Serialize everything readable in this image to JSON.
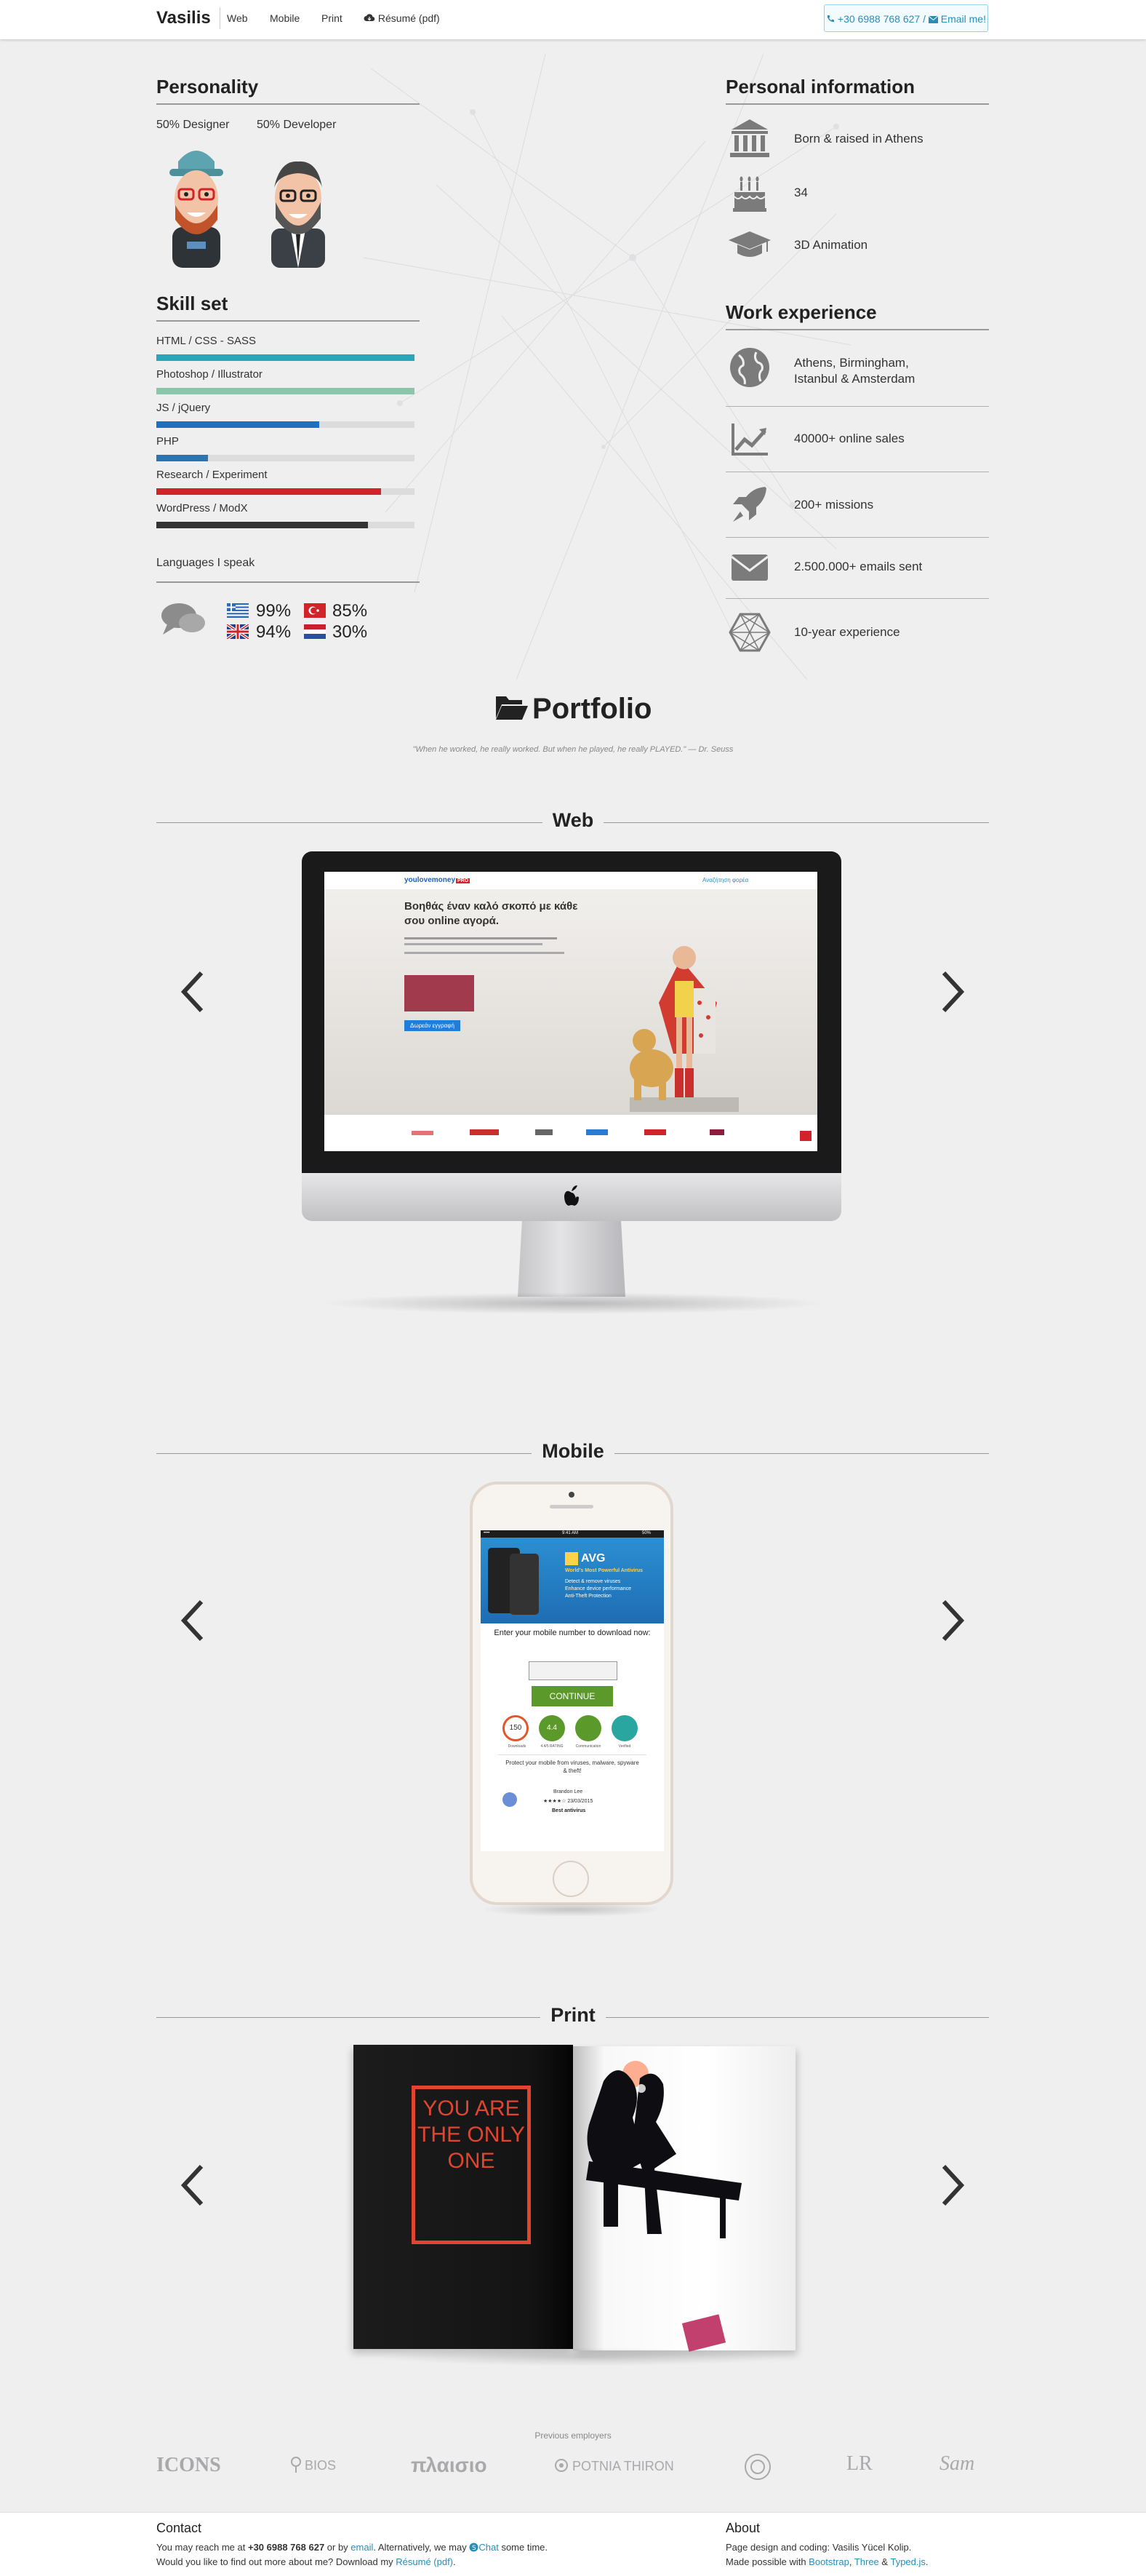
{
  "nav": {
    "brand": "Vasilis",
    "links": [
      "Web",
      "Mobile",
      "Print",
      "Résumé (pdf)"
    ],
    "phone": "+30 6988 768 627",
    "separator": "/",
    "email_label": "Email me!"
  },
  "personality": {
    "title": "Personality",
    "designer": "50% Designer",
    "developer": "50% Developer"
  },
  "skills": {
    "title": "Skill set",
    "items": [
      {
        "label": "HTML / CSS - SASS",
        "level": 1.0,
        "color": "#29a6b8"
      },
      {
        "label": "Photoshop / Illustrator",
        "level": 1.0,
        "color": "#8cc6aa"
      },
      {
        "label": "JS / jQuery",
        "level": 0.63,
        "color": "#1f6fbf"
      },
      {
        "label": "PHP",
        "level": 0.2,
        "color": "#2b74b0"
      },
      {
        "label": "Research / Experiment",
        "level": 0.87,
        "color": "#d0232a"
      },
      {
        "label": "WordPress / ModX",
        "level": 0.82,
        "color": "#333333"
      }
    ]
  },
  "languages": {
    "title": "Languages I speak",
    "items": [
      {
        "flag": "greece-flag",
        "pct": "99%"
      },
      {
        "flag": "turkey-flag",
        "pct": "85%"
      },
      {
        "flag": "uk-flag",
        "pct": "94%"
      },
      {
        "flag": "netherlands-flag",
        "pct": "30%"
      }
    ]
  },
  "personal": {
    "title": "Personal information",
    "items": [
      {
        "icon": "museum-icon",
        "text": "Born & raised in Athens"
      },
      {
        "icon": "cake-icon",
        "text": "34"
      },
      {
        "icon": "graduation-cap-icon",
        "text": "3D Animation"
      }
    ]
  },
  "work": {
    "title": "Work experience",
    "items": [
      {
        "icon": "globe-icon",
        "line1": "Athens, Birmingham,",
        "line2": "Istanbul & Amsterdam"
      },
      {
        "icon": "chart-icon",
        "line1": "40000+ online sales",
        "line2": ""
      },
      {
        "icon": "rocket-icon",
        "line1": "200+ missions",
        "line2": ""
      },
      {
        "icon": "envelope-icon",
        "line1": "2.500.000+ emails sent",
        "line2": ""
      },
      {
        "icon": "polygon-icon",
        "line1": "10-year experience",
        "line2": ""
      }
    ]
  },
  "portfolio": {
    "title": "Portfolio",
    "quote": "\"When he worked, he really worked. But when he played, he really PLAYED.\"",
    "quote_author": "— Dr. Seuss",
    "sections": [
      "Web",
      "Mobile",
      "Print"
    ]
  },
  "web_shot": {
    "brand": "youlovemoney",
    "brand_accent": "PRO",
    "menu": "Αναζήτηση φορέα",
    "headline1": "Βοηθάς έναν καλό σκοπό με κάθε",
    "headline2": "σου online αγορά.",
    "cta": "Δωρεάν εγγραφή"
  },
  "mobile_shot": {
    "status_left": "•••• ",
    "status_time": "9:41 AM",
    "status_right": "50%",
    "app_name": "AVG",
    "app_tag": "World's Most Powerful Antivirus",
    "bullets": [
      "Detect & remove viruses",
      "Enhance device performance",
      "Anti-Theft Protection"
    ],
    "prompt": "Enter your mobile number to download now:",
    "button": "CONTINUE",
    "badges": [
      {
        "value": "150",
        "label": "Downloads"
      },
      {
        "value": "4.4",
        "label": "4.4/5 RATING"
      },
      {
        "value": "",
        "label": "Communication"
      },
      {
        "value": "",
        "label": "Verified"
      }
    ],
    "protect": "Protect your mobile from viruses, malware, spyware & theft!",
    "reviewer": "Brandon Lee",
    "review_date": "23/03/2015",
    "review_title": "Best antivirus"
  },
  "print_shot": {
    "line1": "YOU ARE",
    "line2": "THE ONLY",
    "line3": "ONE"
  },
  "employers": {
    "title": "Previous employers",
    "logos": [
      "ICONS",
      "BIOS",
      "πλαισιο",
      "POTNIA THIRON",
      "",
      "LR",
      "Sam"
    ]
  },
  "footer": {
    "contact_title": "Contact",
    "contact_1a": "You may reach me at ",
    "contact_phone": "+30 6988 768 627",
    "contact_1b": " or by ",
    "contact_email": "email",
    "contact_1c": ". Alternatively, we may ",
    "contact_chat": "Chat",
    "contact_1d": " some time.",
    "contact_2a": "Would you like to find out more about me? Download my ",
    "contact_resume": "Résumé (pdf)",
    "contact_2b": ".",
    "about_title": "About",
    "about_1": "Page design and coding: Vasilis Yücel Kolip.",
    "about_2a": "Made possible with ",
    "about_bootstrap": "Bootstrap",
    "about_comma": ", ",
    "about_three": "Three",
    "about_amp": " & ",
    "about_typed": "Typed.js",
    "about_end": "."
  },
  "colors": {
    "background": "#efeff0",
    "accent_blue": "#2a8db8",
    "print_red": "#e2452f"
  }
}
